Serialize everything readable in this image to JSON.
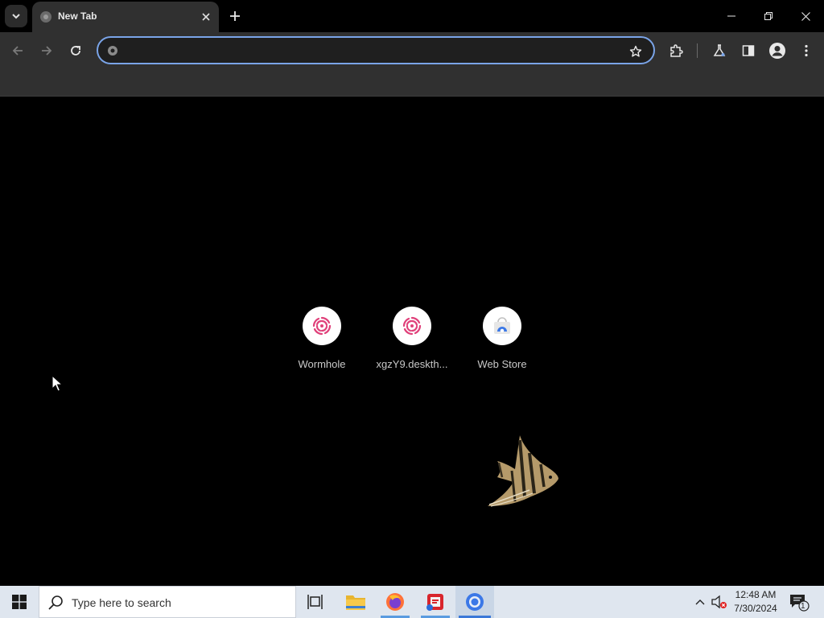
{
  "browser": {
    "tab_title": "New Tab",
    "omnibox_value": "",
    "omnibox_placeholder": ""
  },
  "shortcuts": [
    {
      "label": "Wormhole",
      "icon": "wormhole-icon"
    },
    {
      "label": "xgzY9.deskth...",
      "icon": "wormhole-icon"
    },
    {
      "label": "Web Store",
      "icon": "web-store-icon"
    }
  ],
  "taskbar": {
    "search_placeholder": "Type here to search",
    "time": "12:48 AM",
    "date": "7/30/2024",
    "notification_count": "1"
  },
  "colors": {
    "accent": "#7aa4e8",
    "wormhole_pink": "#e0407a",
    "taskbar_bg": "#dfe6ef"
  }
}
